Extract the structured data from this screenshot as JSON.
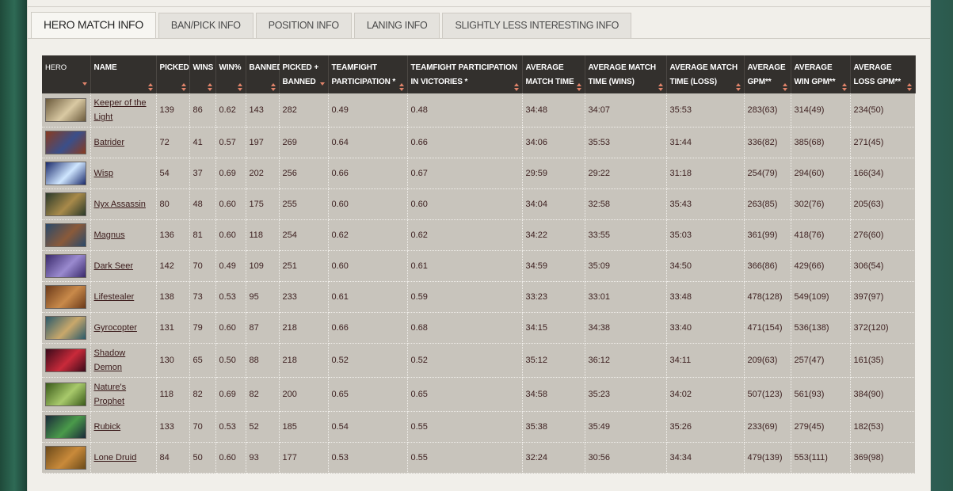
{
  "tabs": [
    {
      "label": "HERO MATCH INFO",
      "active": true
    },
    {
      "label": "BAN/PICK INFO",
      "active": false
    },
    {
      "label": "POSITION INFO",
      "active": false
    },
    {
      "label": "LANING INFO",
      "active": false
    },
    {
      "label": "SLIGHTLY LESS INTERESTING INFO",
      "active": false
    }
  ],
  "table": {
    "columns": [
      "HERO",
      "NAME",
      "PICKED",
      "WINS",
      "WIN%",
      "BANNED",
      "PICKED + BANNED",
      "TEAMFIGHT PARTICIPATION *",
      "TEAMFIGHT PARTICIPATION IN VICTORIES *",
      "AVERAGE MATCH TIME",
      "AVERAGE MATCH TIME (WINS)",
      "AVERAGE MATCH TIME (LOSS)",
      "AVERAGE GPM**",
      "AVERAGE WIN GPM**",
      "AVERAGE LOSS GPM**"
    ],
    "rows": [
      {
        "name": "Keeper of the Light",
        "picked": "139",
        "wins": "86",
        "winpct": "0.62",
        "banned": "143",
        "pb": "282",
        "tf": "0.49",
        "tfv": "0.48",
        "avg": "34:48",
        "avgw": "34:07",
        "avgl": "35:53",
        "gpm": "283(63)",
        "wgpm": "314(49)",
        "lgpm": "234(50)",
        "c1": "#6b5a3c",
        "c2": "#d9c9a3"
      },
      {
        "name": "Batrider",
        "picked": "72",
        "wins": "41",
        "winpct": "0.57",
        "banned": "197",
        "pb": "269",
        "tf": "0.64",
        "tfv": "0.66",
        "avg": "34:06",
        "avgw": "35:53",
        "avgl": "31:44",
        "gpm": "336(82)",
        "wgpm": "385(68)",
        "lgpm": "271(45)",
        "c1": "#8a3b1f",
        "c2": "#3a4f8a"
      },
      {
        "name": "Wisp",
        "picked": "54",
        "wins": "37",
        "winpct": "0.69",
        "banned": "202",
        "pb": "256",
        "tf": "0.66",
        "tfv": "0.67",
        "avg": "29:59",
        "avgw": "29:22",
        "avgl": "31:18",
        "gpm": "254(79)",
        "wgpm": "294(60)",
        "lgpm": "166(34)",
        "c1": "#1a2a6b",
        "c2": "#cfe6ff"
      },
      {
        "name": "Nyx Assassin",
        "picked": "80",
        "wins": "48",
        "winpct": "0.60",
        "banned": "175",
        "pb": "255",
        "tf": "0.60",
        "tfv": "0.60",
        "avg": "34:04",
        "avgw": "32:58",
        "avgl": "35:43",
        "gpm": "263(85)",
        "wgpm": "302(76)",
        "lgpm": "205(63)",
        "c1": "#2a3a2a",
        "c2": "#a88a4a"
      },
      {
        "name": "Magnus",
        "picked": "136",
        "wins": "81",
        "winpct": "0.60",
        "banned": "118",
        "pb": "254",
        "tf": "0.62",
        "tfv": "0.62",
        "avg": "34:22",
        "avgw": "33:55",
        "avgl": "35:03",
        "gpm": "361(99)",
        "wgpm": "418(76)",
        "lgpm": "276(60)",
        "c1": "#2a4a6b",
        "c2": "#8a5a3a"
      },
      {
        "name": "Dark Seer",
        "picked": "142",
        "wins": "70",
        "winpct": "0.49",
        "banned": "109",
        "pb": "251",
        "tf": "0.60",
        "tfv": "0.61",
        "avg": "34:59",
        "avgw": "35:09",
        "avgl": "34:50",
        "gpm": "366(86)",
        "wgpm": "429(66)",
        "lgpm": "306(54)",
        "c1": "#3a2a6b",
        "c2": "#9a8acf"
      },
      {
        "name": "Lifestealer",
        "picked": "138",
        "wins": "73",
        "winpct": "0.53",
        "banned": "95",
        "pb": "233",
        "tf": "0.61",
        "tfv": "0.59",
        "avg": "33:23",
        "avgw": "33:01",
        "avgl": "33:48",
        "gpm": "478(128)",
        "wgpm": "549(109)",
        "lgpm": "397(97)",
        "c1": "#6b3a1a",
        "c2": "#c98a4a"
      },
      {
        "name": "Gyrocopter",
        "picked": "131",
        "wins": "79",
        "winpct": "0.60",
        "banned": "87",
        "pb": "218",
        "tf": "0.66",
        "tfv": "0.68",
        "avg": "34:15",
        "avgw": "34:38",
        "avgl": "33:40",
        "gpm": "471(154)",
        "wgpm": "536(138)",
        "lgpm": "372(120)",
        "c1": "#2a5a6b",
        "c2": "#c9a86b"
      },
      {
        "name": "Shadow Demon",
        "picked": "130",
        "wins": "65",
        "winpct": "0.50",
        "banned": "88",
        "pb": "218",
        "tf": "0.52",
        "tfv": "0.52",
        "avg": "35:12",
        "avgw": "36:12",
        "avgl": "34:11",
        "gpm": "209(63)",
        "wgpm": "257(47)",
        "lgpm": "161(35)",
        "c1": "#3a0a1a",
        "c2": "#c92a3a"
      },
      {
        "name": "Nature's Prophet",
        "picked": "118",
        "wins": "82",
        "winpct": "0.69",
        "banned": "82",
        "pb": "200",
        "tf": "0.65",
        "tfv": "0.65",
        "avg": "34:58",
        "avgw": "35:23",
        "avgl": "34:02",
        "gpm": "507(123)",
        "wgpm": "561(93)",
        "lgpm": "384(90)",
        "c1": "#3a5a1a",
        "c2": "#a8c96b"
      },
      {
        "name": "Rubick",
        "picked": "133",
        "wins": "70",
        "winpct": "0.53",
        "banned": "52",
        "pb": "185",
        "tf": "0.54",
        "tfv": "0.55",
        "avg": "35:38",
        "avgw": "35:49",
        "avgl": "35:26",
        "gpm": "233(69)",
        "wgpm": "279(45)",
        "lgpm": "182(53)",
        "c1": "#1a2a3a",
        "c2": "#4a9a4a"
      },
      {
        "name": "Lone Druid",
        "picked": "84",
        "wins": "50",
        "winpct": "0.60",
        "banned": "93",
        "pb": "177",
        "tf": "0.53",
        "tfv": "0.55",
        "avg": "32:24",
        "avgw": "30:56",
        "avgl": "34:34",
        "gpm": "479(139)",
        "wgpm": "553(111)",
        "lgpm": "369(98)",
        "c1": "#6b4a1a",
        "c2": "#c98a3a"
      }
    ]
  }
}
